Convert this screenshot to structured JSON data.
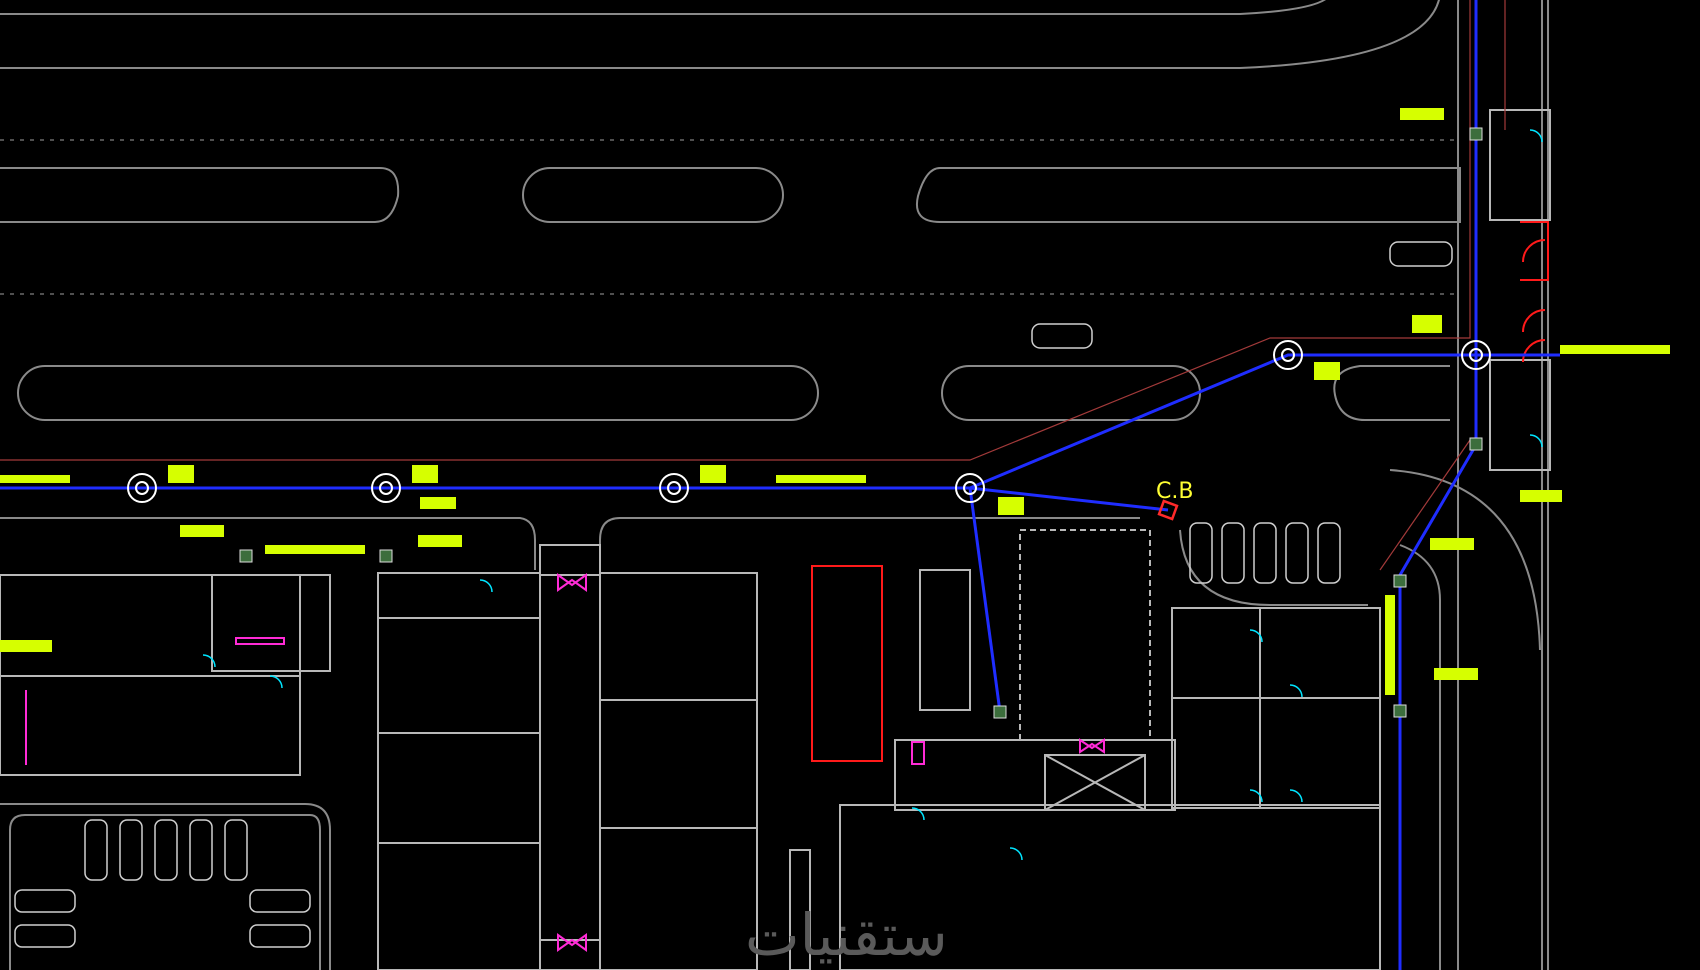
{
  "drawing": {
    "background": "#000000",
    "colors": {
      "road_outline": "#8a8a8a",
      "building_line": "#b8b8b8",
      "pipe": "#1f2dff",
      "reference_line": "#a33a3a",
      "label_fill": "#d6ff00",
      "tag": "#c8ff00",
      "manhole": "#ffffff",
      "catch_basin": "#ff2a2a",
      "door_swing": "#00e5ff",
      "magenta_mark": "#ff2bd6",
      "red_outline": "#ff1a1a",
      "cb_label": "#ffff33",
      "watermark": "#5a5a5a"
    },
    "catch_basin_label": "C.B",
    "watermark_text": "ستقنيات"
  }
}
